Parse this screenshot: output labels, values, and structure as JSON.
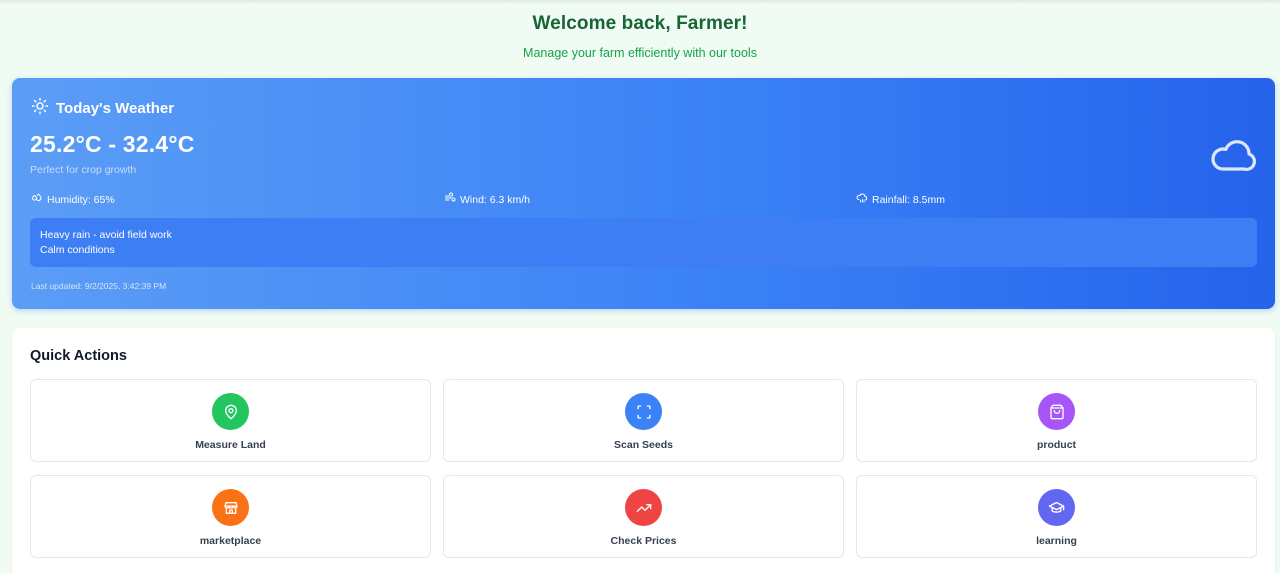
{
  "header": {
    "title": "Welcome back, Farmer!",
    "subtitle": "Manage your farm efficiently with our tools"
  },
  "weather": {
    "title": "Today's Weather",
    "title_icon": "sun-icon",
    "temperature_range": "25.2°C - 32.4°C",
    "condition_note": "Perfect for crop growth",
    "condition_icon": "cloud-icon",
    "stats": {
      "humidity": "Humidity: 65%",
      "wind": "Wind: 6.3 km/h",
      "rainfall": "Rainfall: 8.5mm"
    },
    "alerts": [
      "Heavy rain - avoid field work",
      "Calm conditions"
    ],
    "last_updated": "Last updated: 9/2/2025, 3:42:39 PM"
  },
  "quick_actions": {
    "title": "Quick Actions",
    "items": [
      {
        "label": "Measure Land",
        "icon": "map-pin-icon",
        "color": "#22c55e"
      },
      {
        "label": "Scan Seeds",
        "icon": "scan-icon",
        "color": "#3b82f6"
      },
      {
        "label": "product",
        "icon": "shopping-bag-icon",
        "color": "#a855f7"
      },
      {
        "label": "marketplace",
        "icon": "store-icon",
        "color": "#f97316"
      },
      {
        "label": "Check Prices",
        "icon": "trending-up-icon",
        "color": "#ef4444"
      },
      {
        "label": "learning",
        "icon": "graduation-cap-icon",
        "color": "#6366f1"
      }
    ]
  }
}
